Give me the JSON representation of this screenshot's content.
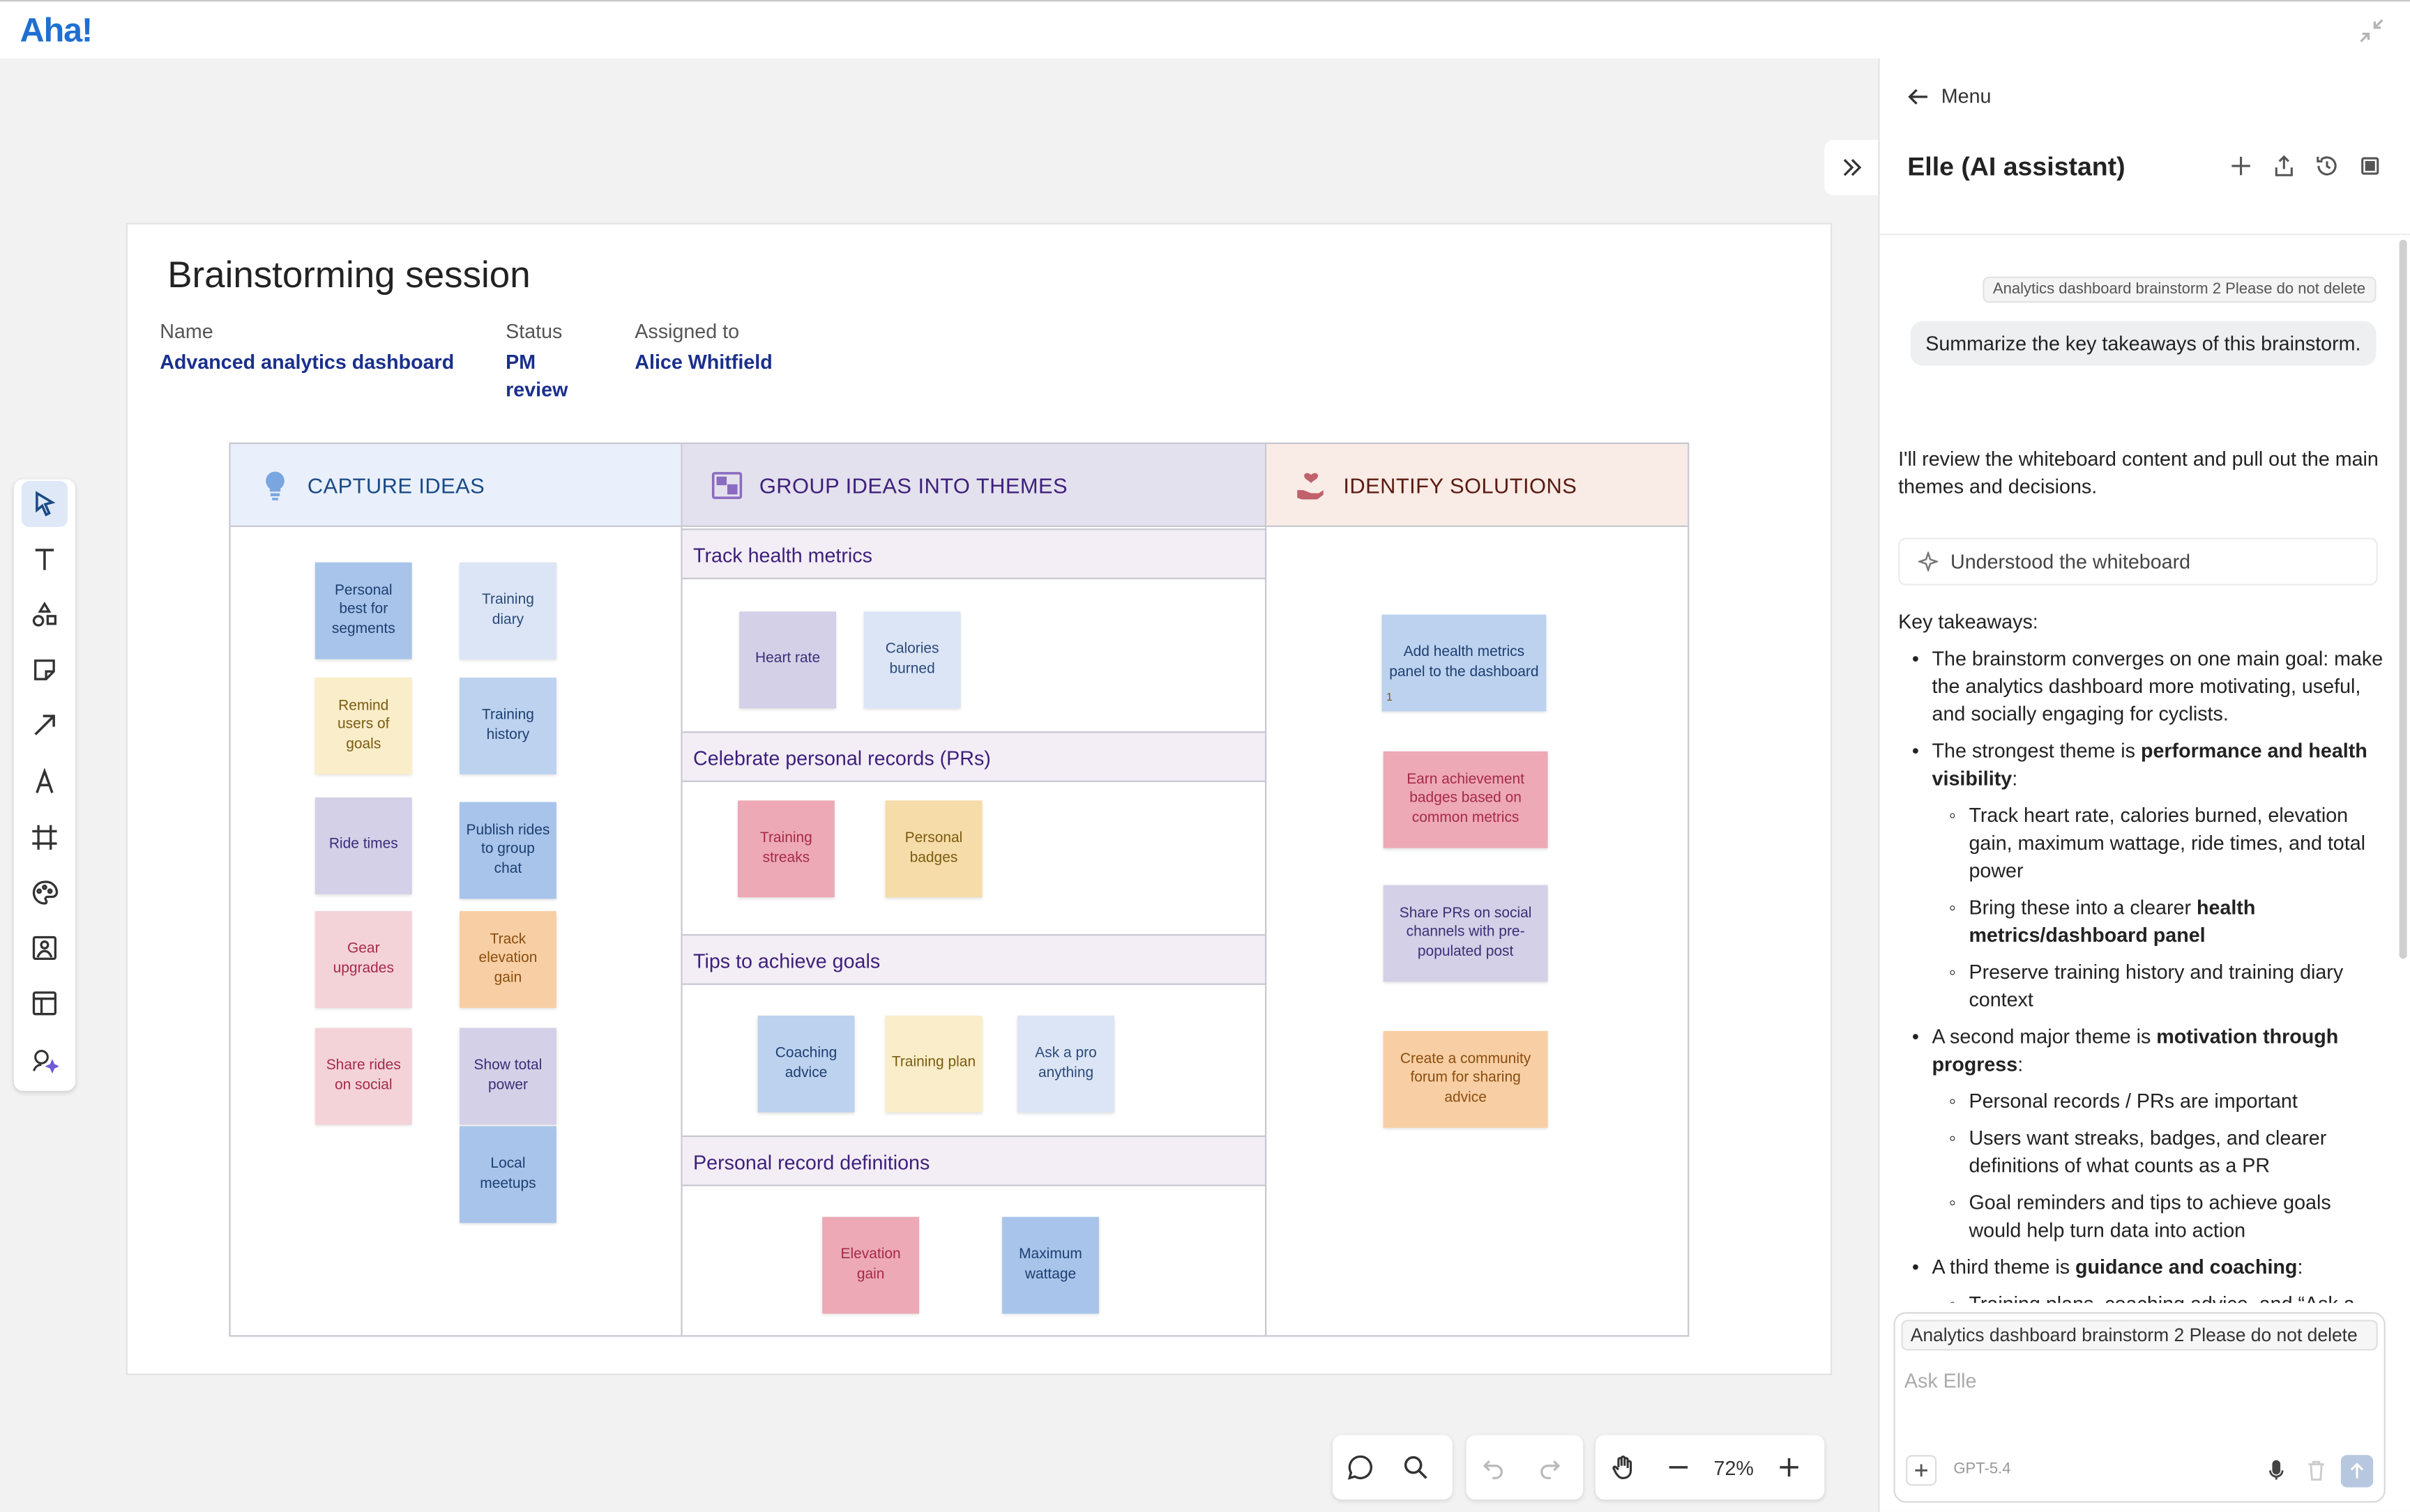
{
  "app": {
    "logo": "Aha!"
  },
  "board": {
    "title": "Brainstorming session",
    "fields": [
      {
        "label": "Name",
        "value": "Advanced analytics dashboard"
      },
      {
        "label": "Status",
        "value": "PM review"
      },
      {
        "label": "Assigned to",
        "value": "Alice Whitfield"
      }
    ],
    "columns": [
      {
        "title": "CAPTURE IDEAS",
        "icon": "lightbulb-icon"
      },
      {
        "title": "GROUP IDEAS INTO THEMES",
        "icon": "group-icon"
      },
      {
        "title": "IDENTIFY SOLUTIONS",
        "icon": "hand-heart-icon"
      }
    ],
    "capture_ideas": [
      "Personal best for segments",
      "Training diary",
      "Remind users of goals",
      "Training history",
      "Ride times",
      "Publish rides to group chat",
      "Gear upgrades",
      "Track elevation gain",
      "Share rides on social",
      "Show total power",
      "Local meetups"
    ],
    "themes": [
      {
        "title": "Track health metrics",
        "notes": [
          "Heart rate",
          "Calories burned"
        ]
      },
      {
        "title": "Celebrate personal records (PRs)",
        "notes": [
          "Training streaks",
          "Personal badges"
        ]
      },
      {
        "title": "Tips to achieve goals",
        "notes": [
          "Coaching advice",
          "Training plan",
          "Ask a pro anything"
        ]
      },
      {
        "title": "Personal record definitions",
        "notes": [
          "Elevation gain",
          "Maximum wattage"
        ]
      }
    ],
    "solutions": [
      "Add health metrics panel to the dashboard",
      "Earn achievement badges based on common metrics",
      "Share PRs on social channels with pre-populated post",
      "Create a community forum for sharing advice"
    ],
    "solution_badge": "1"
  },
  "controls": {
    "zoom": "72%"
  },
  "panel": {
    "menu_label": "Menu",
    "title": "Elle (AI assistant)",
    "context_chip": "Analytics dashboard brainstorm 2 Please do not delete",
    "user_message": "Summarize the key takeaways of this brainstorm.",
    "ai_intro": "I'll review the whiteboard content and pull out the main themes and decisions.",
    "understood": "Understood the whiteboard",
    "key_heading": "Key takeaways:",
    "b1": "The brainstorm converges on one main goal: make the analytics dashboard more motivating, useful, and socially engaging for cyclists.",
    "b2_pre": "The strongest theme is ",
    "b2_bold": "performance and health visibility",
    "b2_post": ":",
    "b2_s1": "Track heart rate, calories burned, elevation gain, maximum wattage, ride times, and total power",
    "b2_s2_pre": "Bring these into a clearer ",
    "b2_s2_bold": "health metrics/dashboard panel",
    "b2_s3": "Preserve training history and training diary context",
    "b3_pre": "A second major theme is ",
    "b3_bold": "motivation through progress",
    "b3_post": ":",
    "b3_s1": "Personal records / PRs are important",
    "b3_s2": "Users want streaks, badges, and clearer definitions of what counts as a PR",
    "b3_s3": "Goal reminders and tips to achieve goals would help turn data into action",
    "b4_pre": "A third theme is ",
    "b4_bold": "guidance and coaching",
    "b4_post": ":",
    "b4_s1": "Training plans, coaching advice, and “Ask a pro anything”",
    "composer_chip": "Analytics dashboard brainstorm 2 Please do not delete",
    "composer_placeholder": "Ask Elle",
    "model": "GPT-5.4"
  }
}
